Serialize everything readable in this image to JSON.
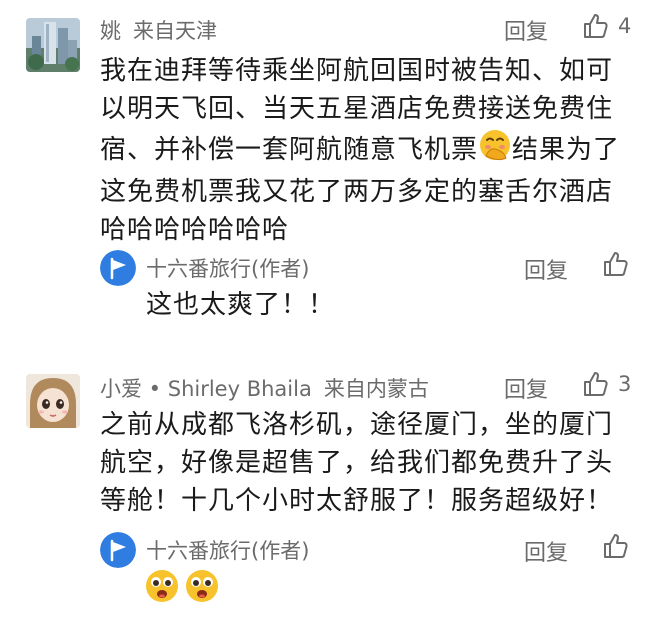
{
  "comments": [
    {
      "author": "姚",
      "location": "来自天津",
      "reply_label": "回复",
      "likes": "4",
      "lines": [
        "我在迪拜等待乘坐阿航回国时被告知、如可",
        "以明天飞回、当天五星酒店免费接送免费住",
        "宿、并补偿一套阿航随意飞机票",
        "这免费机票我又花了两万多定的塞舌尔酒店",
        "哈哈哈哈哈哈哈"
      ],
      "line3_after_emoji": "结果为了",
      "emoji": "hand-over-mouth-emoji",
      "reply": {
        "author": "十六番旅行(作者)",
        "reply_label": "回复",
        "text": "这也太爽了！！"
      }
    },
    {
      "author": "小爱 • Shirley Bhaila",
      "location": "来自内蒙古",
      "reply_label": "回复",
      "likes": "3",
      "lines": [
        "之前从成都飞洛杉矶，途径厦门，坐的厦门",
        "航空，好像是超售了，给我们都免费升了头",
        "等舱！十几个小时太舒服了！服务超级好！"
      ],
      "reply": {
        "author": "十六番旅行(作者)",
        "reply_label": "回复",
        "emojis": [
          "open-mouth-emoji",
          "open-mouth-emoji"
        ]
      }
    }
  ],
  "colors": {
    "text": "#1a1a1a",
    "meta": "#6b6b6b",
    "author_badge": "#2f7de1"
  }
}
